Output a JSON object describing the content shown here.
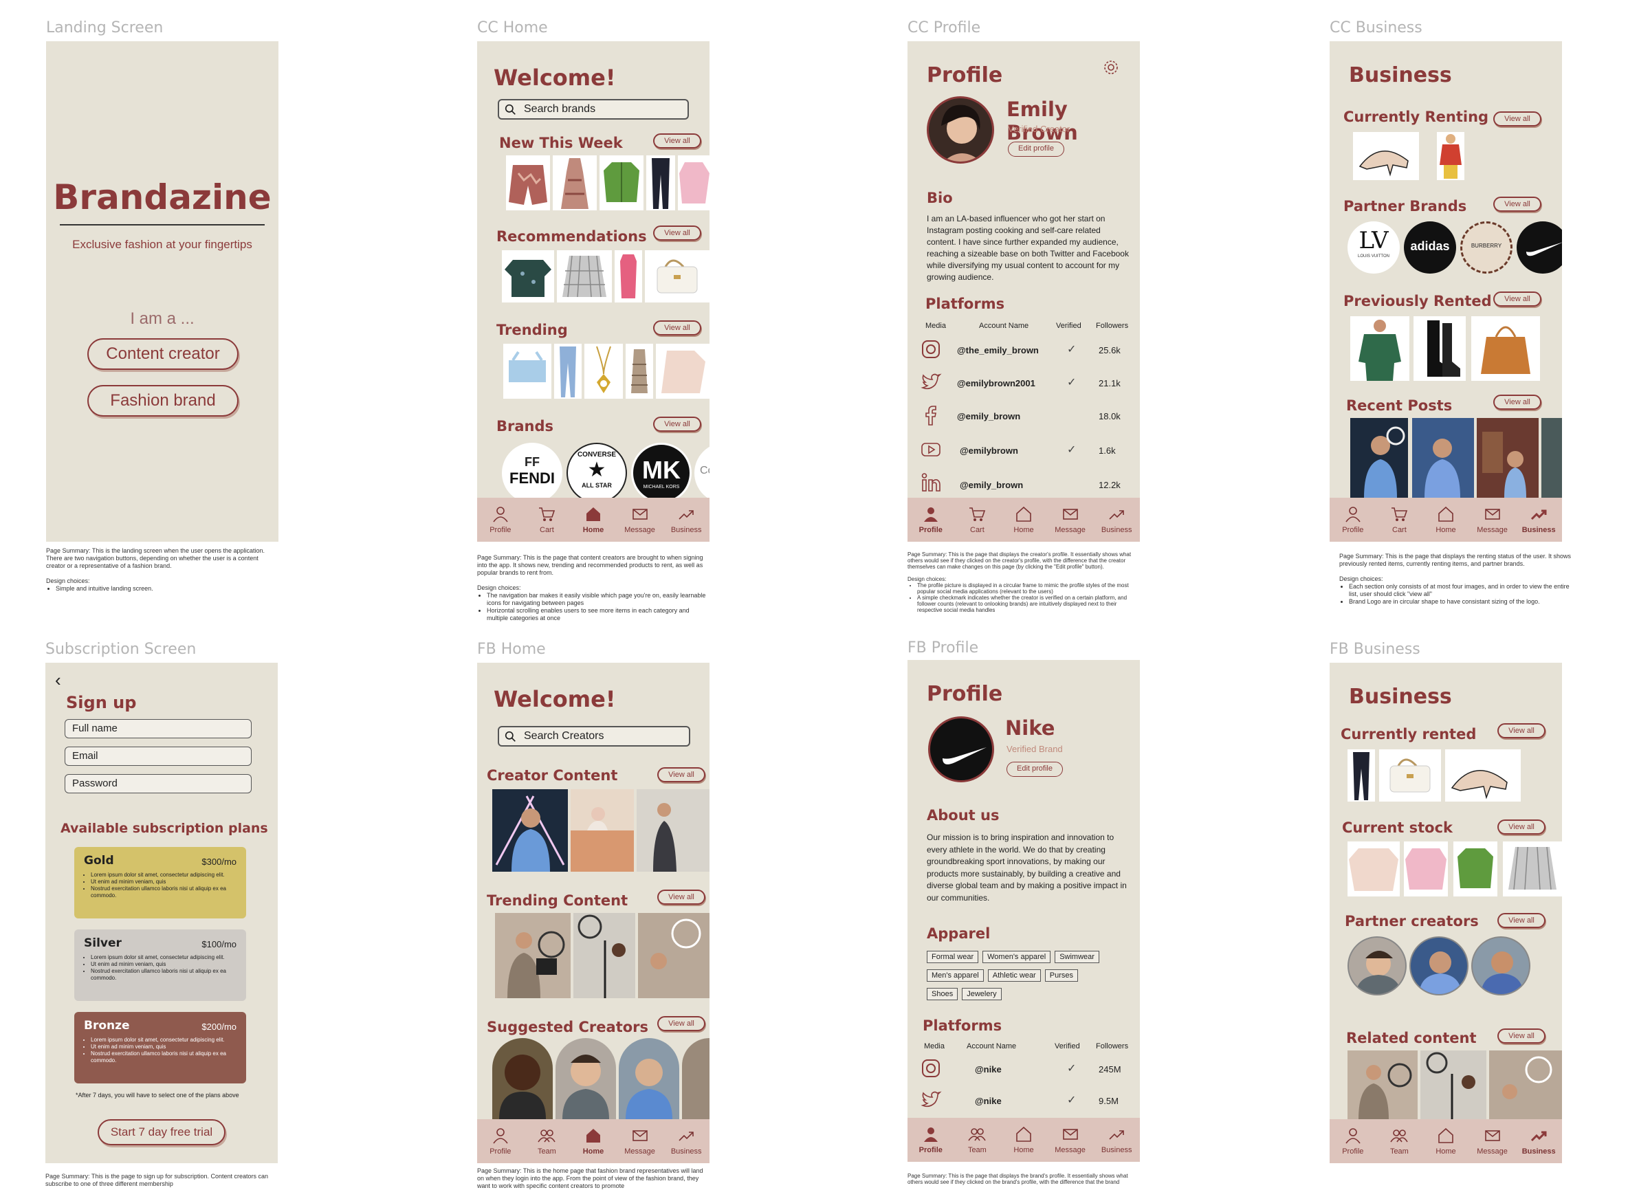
{
  "frames": {
    "landing": {
      "label": "Landing Screen",
      "brand": "Brandazine",
      "tagline": "Exclusive fashion at your fingertips",
      "prompt": "I am a ...",
      "btn_creator": "Content creator",
      "btn_brand": "Fashion brand",
      "summary": "Page Summary: This is the landing screen when the user opens the application. There are two navigation buttons, depending on whether the user is a content creator or a representative of a fashion brand.",
      "design_title": "Design choices:",
      "design": [
        "Simple and intuitive landing screen."
      ]
    },
    "cc_home": {
      "label": "CC Home",
      "welcome": "Welcome!",
      "search_placeholder": "Search brands",
      "s1": "New This Week",
      "s2": "Recommendations",
      "s3": "Trending",
      "s4": "Brands",
      "view_all": "View all",
      "brand1": "FENDI",
      "brand1_mark": "FF",
      "brand2": "CONVERSE",
      "brand2_sub": "ALL STAR",
      "brand3": "MK",
      "brand3_sub": "MICHAEL KORS",
      "brand4": "Co",
      "summary": "Page Summary: This is the page that content creators are brought to when signing into the app. It shows new, trending and recommended products to rent, as well as popular brands to rent from.",
      "design_title": "Design choices:",
      "design": [
        "The navigation bar makes it easily visible which page you're on, easily learnable icons for navigating between pages",
        "Horizontal scrolling enables users to see more items in each category and multiple categories at once"
      ]
    },
    "cc_profile": {
      "label": "CC Profile",
      "title": "Profile",
      "name": "Emily Brown",
      "role": "Verified Creator",
      "edit": "Edit profile",
      "bio_title": "Bio",
      "bio": "I am an LA-based influencer who got her start on Instagram posting cooking and self-care related content. I have since further expanded my audience, reaching a sizeable base on both Twitter and Facebook while diversifying my usual content to account for my growing audience.",
      "platforms_title": "Platforms",
      "col_media": "Media",
      "col_account": "Account Name",
      "col_verified": "Verified",
      "col_followers": "Followers",
      "rows": [
        {
          "icon": "instagram-icon",
          "acct": "@the_emily_brown",
          "verified": "✓",
          "followers": "25.6k"
        },
        {
          "icon": "twitter-icon",
          "acct": "@emilybrown2001",
          "verified": "✓",
          "followers": "21.1k"
        },
        {
          "icon": "facebook-icon",
          "acct": "@emily_brown",
          "verified": "",
          "followers": "18.0k"
        },
        {
          "icon": "youtube-icon",
          "acct": "@emilybrown",
          "verified": "✓",
          "followers": "1.6k"
        },
        {
          "icon": "linkedin-icon",
          "acct": "@emily_brown",
          "verified": "",
          "followers": "12.2k"
        }
      ],
      "summary": "Page Summary: This is the page that displays the creator's profile. It essentially shows what others would see if they clicked on the creator's profile, with the difference that the creator themselves can make changes on this page (by clicking the \"Edit profile\" button).",
      "design_title": "Design choices:",
      "design": [
        "The profile picture is displayed in a circular frame to mimic the profile styles of the most popular social media applications (relevant to the users)",
        "A simple checkmark indicates whether the creator is verified on a certain platform, and follower counts (relevant to onlooking brands) are intuitively displayed next to their respective social media handles"
      ]
    },
    "cc_business": {
      "label": "CC Business",
      "title": "Business",
      "s1": "Currently Renting",
      "s2": "Partner Brands",
      "s3": "Previously Rented",
      "s4": "Recent Posts",
      "view_all": "View all",
      "b1": "LV",
      "b1_sub": "LOUIS VUITTON",
      "b2": "adidas",
      "b3": "BURBERRY",
      "summary": "Page Summary: This is the page that displays the renting status of the user. It shows previously rented items, currently renting items, and partner brands.",
      "design_title": "Design choices:",
      "design": [
        "Each section only consists of at most four images, and in order to view the entire list, user should click \"view all\"",
        "Brand Logo are in circular shape to have consistant sizing of the logo."
      ]
    },
    "subscription": {
      "label": "Subscription Screen",
      "back": "‹",
      "title": "Sign up",
      "f1": "Full name",
      "f2": "Email",
      "f3": "Password",
      "plans_title": "Available subscription plans",
      "plans": [
        {
          "name": "Gold",
          "price": "$300/mo",
          "color": "#d4c26a"
        },
        {
          "name": "Silver",
          "price": "$100/mo",
          "color": "#cfcbc6"
        },
        {
          "name": "Bronze",
          "price": "$200/mo",
          "color": "#8f5a4e"
        }
      ],
      "lorem": [
        "Lorem ipsum dolor sit amet, consectetur adipiscing elit.",
        "Ut enim ad minim veniam, quis",
        "Nostrud exercitation ullamco laboris nisi ut aliquip ex ea commodo."
      ],
      "note": "*After 7 days, you will have to select one of the plans above",
      "trial": "Start 7 day free trial",
      "summary": "Page Summary: This is the page to sign up for subscription. Content creators can subscribe to one of three different membership"
    },
    "fb_home": {
      "label": "FB Home",
      "welcome": "Welcome!",
      "search_placeholder": "Search Creators",
      "s1": "Creator Content",
      "s2": "Trending Content",
      "s3": "Suggested Creators",
      "view_all": "View all",
      "summary": "Page Summary: This is the home page that fashion brand representatives will land on when they login into the app. From the point of view of the fashion brand, they want to work with specific content creators to promote"
    },
    "fb_profile": {
      "label": "FB Profile",
      "title": "Profile",
      "name": "Nike",
      "role": "Verified Brand",
      "edit": "Edit profile",
      "about_title": "About us",
      "about": "Our mission is to bring inspiration and innovation to every athlete in the world. We do that by creating groundbreaking sport innovations, by making our products more sustainably, by building a creative and diverse global team and by making a positive impact in our communities.",
      "apparel_title": "Apparel",
      "tags": [
        [
          "Formal wear",
          "Women's apparel",
          "Swimwear"
        ],
        [
          "Men's apparel",
          "Athletic wear",
          "Purses"
        ],
        [
          "Shoes",
          "Jewelery"
        ]
      ],
      "platforms_title": "Platforms",
      "col_media": "Media",
      "col_account": "Account Name",
      "col_verified": "Verified",
      "col_followers": "Followers",
      "rows": [
        {
          "icon": "instagram-icon",
          "acct": "@nike",
          "verified": "✓",
          "followers": "245M"
        },
        {
          "icon": "twitter-icon",
          "acct": "@nike",
          "verified": "✓",
          "followers": "9.5M"
        }
      ],
      "summary": "Page Summary: This is the page that displays the brand's profile. It essentially shows what others would see if they clicked on the brand's profile, with the difference that the brand"
    },
    "fb_business": {
      "label": "FB Business",
      "title": "Business",
      "s1": "Currently rented",
      "s2": "Current stock",
      "s3": "Partner creators",
      "s4": "Related content",
      "view_all": "View all"
    }
  },
  "tabs_cc": [
    "Profile",
    "Cart",
    "Home",
    "Message",
    "Business"
  ],
  "tabs_fb": [
    "Profile",
    "Team",
    "Home",
    "Message",
    "Business"
  ],
  "colors": {
    "bg": "#e6e2d6",
    "accent": "#8b3a3a",
    "tabbar": "#ddc4bc"
  }
}
